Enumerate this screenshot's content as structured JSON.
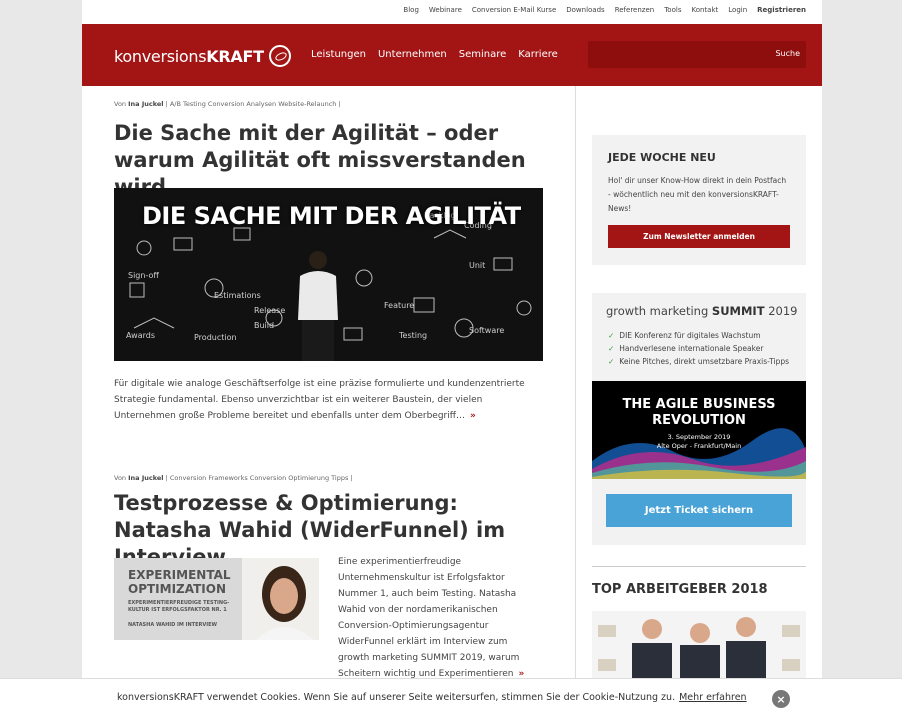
{
  "topnav": [
    "Blog",
    "Webinare",
    "Conversion E-Mail Kurse",
    "Downloads",
    "Referenzen",
    "Tools",
    "Kontakt",
    "Login",
    "Registrieren"
  ],
  "brand": {
    "light": "konversions",
    "bold": "KRAFT"
  },
  "mainnav": [
    "Leistungen",
    "Unternehmen",
    "Seminare",
    "Karriere"
  ],
  "search": {
    "button": "Suche",
    "placeholder": ""
  },
  "article1": {
    "author_prefix": "Von",
    "author": "Ina Juckel",
    "tags": "A/B Testing Conversion Analysen Website-Relaunch |",
    "title": "Die Sache mit der Agilität – oder warum Agilität oft missverstanden wird",
    "image_banner": "DIE SACHE MIT DER AGILITÄT",
    "excerpt": "Für digitale wie analoge Geschäftserfolge ist eine präzise formulierte und kundenzentrierte Strategie fundamental. Ebenso unverzichtbar ist ein weiterer Baustein, der vielen Unternehmen große Probleme bereitet und ebenfalls unter dem Oberbegriff…",
    "more": "»"
  },
  "article2": {
    "author_prefix": "Von",
    "author": "Ina Juckel",
    "tags": "Conversion Frameworks Conversion Optimierung Tipps |",
    "title": "Testprozesse & Optimierung: Natasha Wahid (WiderFunnel) im Interview",
    "image_title": "EXPERIMENTAL OPTIMIZATION",
    "image_subtitle": "EXPERIMENTIERFREUDIGE TESTING-KULTUR IST ERFOLGSFAKTOR NR. 1",
    "image_caption": "NATASHA WAHID IM INTERVIEW",
    "excerpt": "Eine experimentierfreudige Unternehmenskultur ist Erfolgsfaktor Nummer 1, auch beim Testing. Natasha Wahid von der nordamerikanischen Conversion-Optimierungsagentur WiderFunnel erklärt im Interview zum growth marketing SUMMIT 2019, warum Scheitern wichtig und Experimentieren",
    "more": "»"
  },
  "newsletter": {
    "heading": "JEDE WOCHE NEU",
    "text": "Hol' dir unser Know-How direkt in dein Postfach - wöchentlich neu mit den konversionsKRAFT-News!",
    "button": "Zum Newsletter anmelden"
  },
  "summit": {
    "head_light": "growth marketing",
    "head_bold": "SUMMIT",
    "head_year": "2019",
    "bullets": [
      "DIE Konferenz für digitales Wachstum",
      "Handverlesene internationale Speaker",
      "Keine Pitches, direkt umsetzbare Praxis-Tipps"
    ],
    "banner_title": "THE AGILE BUSINESS REVOLUTION",
    "banner_date": "3. September 2019",
    "banner_place": "Alte Oper - Frankfurt/Main",
    "ticket": "Jetzt Ticket sichern"
  },
  "top_arbeitgeber": {
    "heading": "TOP ARBEITGEBER 2018"
  },
  "cookie": {
    "text": "konversionsKRAFT verwendet Cookies. Wenn Sie auf unserer Seite weitersurfen, stimmen Sie der Cookie-Nutzung zu.",
    "link": "Mehr erfahren",
    "close": "×"
  },
  "colors": {
    "brand": "#a31515",
    "ticket": "#4aa3d6"
  }
}
